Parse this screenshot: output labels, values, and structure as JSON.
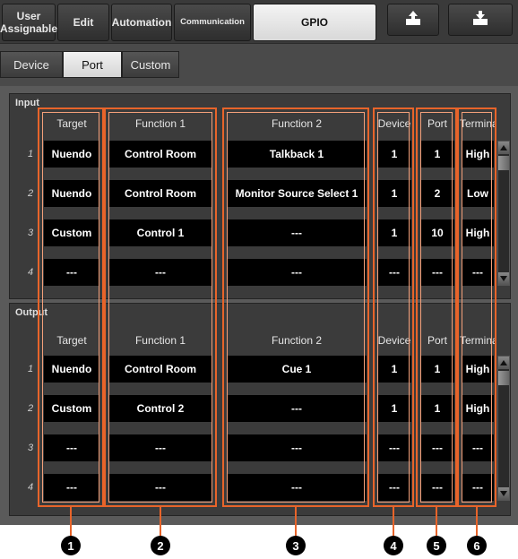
{
  "top_tabs": [
    {
      "label": "User\nAssignable",
      "active": false
    },
    {
      "label": "Edit",
      "active": false
    },
    {
      "label": "Automation",
      "active": false
    },
    {
      "label": "Communication",
      "active": false
    },
    {
      "label": "GPIO",
      "active": true
    }
  ],
  "icon_buttons": [
    {
      "icon": "upload-icon"
    },
    {
      "icon": "download-icon"
    }
  ],
  "sub_tabs": [
    {
      "label": "Device",
      "active": false
    },
    {
      "label": "Port",
      "active": true
    },
    {
      "label": "Custom",
      "active": false
    }
  ],
  "input": {
    "section_label": "Input",
    "headers": [
      "Target",
      "Function 1",
      "Function 2",
      "Device",
      "Port",
      "Terminal"
    ],
    "rows": [
      {
        "num": "1",
        "target": "Nuendo",
        "function1": "Control Room",
        "function2": "Talkback 1",
        "device": "1",
        "port": "1",
        "terminal": "High"
      },
      {
        "num": "2",
        "target": "Nuendo",
        "function1": "Control Room",
        "function2": "Monitor Source Select 1",
        "device": "1",
        "port": "2",
        "terminal": "Low"
      },
      {
        "num": "3",
        "target": "Custom",
        "function1": "Control 1",
        "function2": "---",
        "device": "1",
        "port": "10",
        "terminal": "High"
      },
      {
        "num": "4",
        "target": "---",
        "function1": "---",
        "function2": "---",
        "device": "---",
        "port": "---",
        "terminal": "---"
      }
    ]
  },
  "output": {
    "section_label": "Output",
    "headers": [
      "Target",
      "Function 1",
      "Function 2",
      "Device",
      "Port",
      "Terminal"
    ],
    "rows": [
      {
        "num": "1",
        "target": "Nuendo",
        "function1": "Control Room",
        "function2": "Cue 1",
        "device": "1",
        "port": "1",
        "terminal": "High"
      },
      {
        "num": "2",
        "target": "Custom",
        "function1": "Control 2",
        "function2": "---",
        "device": "1",
        "port": "1",
        "terminal": "High"
      },
      {
        "num": "3",
        "target": "---",
        "function1": "---",
        "function2": "---",
        "device": "---",
        "port": "---",
        "terminal": "---"
      },
      {
        "num": "4",
        "target": "---",
        "function1": "---",
        "function2": "---",
        "device": "---",
        "port": "---",
        "terminal": "---"
      }
    ]
  },
  "callouts": [
    "1",
    "2",
    "3",
    "4",
    "5",
    "6"
  ],
  "colors": {
    "highlight": "#e8642a",
    "cell_bg": "#000000",
    "panel_bg": "#3b3b3b"
  }
}
